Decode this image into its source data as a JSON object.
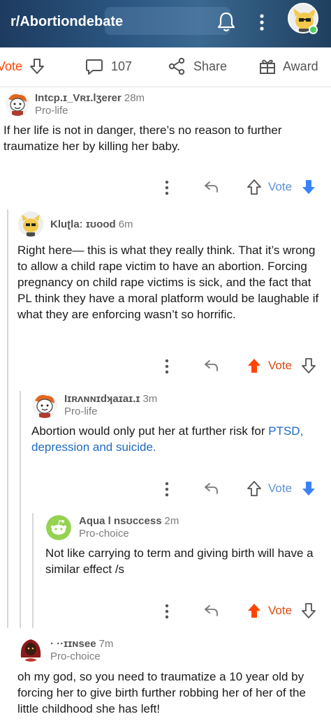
{
  "header": {
    "subreddit": "r/Abortiondebate"
  },
  "action_bar": {
    "vote_label": "Vote",
    "comment_count": "107",
    "share_label": "Share",
    "award_label": "Award"
  },
  "comments": [
    {
      "username": "Intcp.ɪ_Vʀɪ.lʒerer",
      "time": "28m",
      "flair": "Pro-life",
      "body": "If her life is not in danger, there’s no reason to further traumatize her by killing her baby.",
      "vote_label": "Vote",
      "vote_state": "downvoted"
    },
    {
      "username": "Kluʈlaː ɪʊood",
      "time": "6m",
      "flair": "",
      "body": "Right here— this is what they really think. That it’s wrong to allow a child rape victim to have an abortion. Forcing pregnancy on child rape victims is sick, and the fact that PL think they have a moral platform would be laughable if what they are enforcing wasn’t so horrific.",
      "vote_label": "Vote",
      "vote_state": "upvoted"
    },
    {
      "username": "Iɪʀʌɴɴɪdʞaɪaɪ.ɪ",
      "time": "3m",
      "flair": "Pro-life",
      "body_text": "Abortion would only put her at further risk for ",
      "body_link": "PTSD, depression and suicide.",
      "vote_label": "Vote",
      "vote_state": "downvoted"
    },
    {
      "username": "Aqua l nsʊccess",
      "time": "2m",
      "flair": "Pro-choice",
      "body": "Not like carrying to term and giving birth will have a similar effect /s",
      "vote_label": "Vote",
      "vote_state": "upvoted"
    },
    {
      "username": "· ··ɪɪɴsee",
      "time": "7m",
      "flair": "Pro-choice",
      "body": "oh my god, so you need to traumatize a 10 year old by forcing her to give birth further robbing her of her of the little childhood she has left!"
    }
  ],
  "colors": {
    "header_bg": "#22446b",
    "upvote_active": "#ff4500",
    "downvote_active": "#3b82f6",
    "vote_text": "#5b8fd6",
    "link": "#1f6ac2",
    "thread_line": "#d6d6d6"
  }
}
